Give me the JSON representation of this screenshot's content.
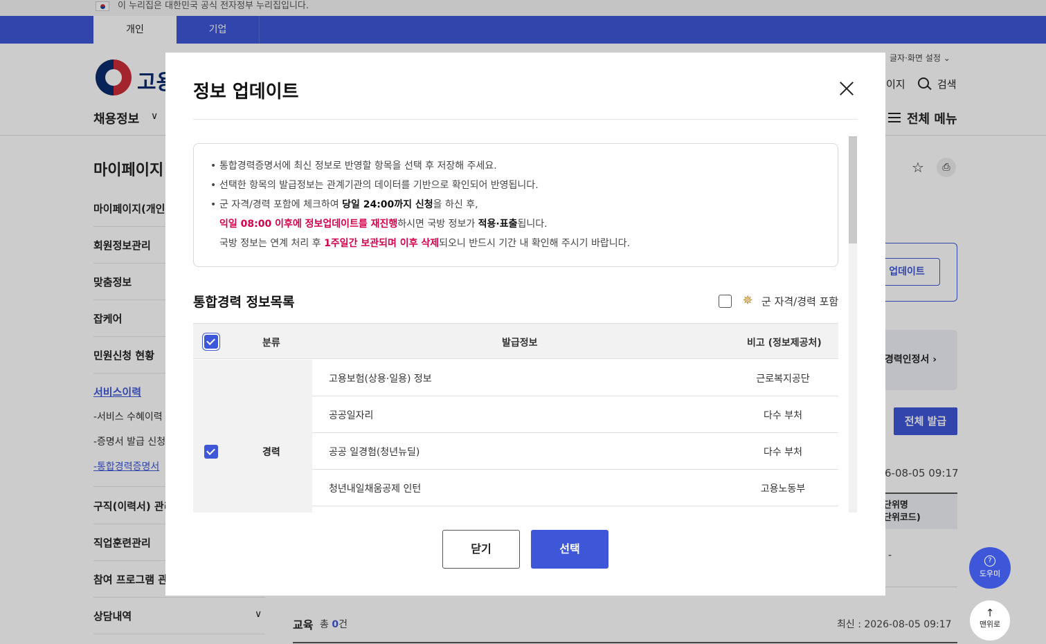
{
  "gov_banner": {
    "text": "이 누리집은 대한민국 공식 전자정부 누리집입니다."
  },
  "top_tabs": [
    {
      "label": "개인"
    },
    {
      "label": "기업"
    }
  ],
  "header": {
    "logo_text": "고용",
    "font_settings": "글자·화면 설정",
    "mypage_partial": "이지",
    "search_label": "검색",
    "gnb_first": "채용정보",
    "all_menu": "전체 메뉴"
  },
  "sidebar": {
    "title": "마이페이지",
    "items": [
      {
        "label": "마이페이지(개인)"
      },
      {
        "label": "회원정보관리"
      },
      {
        "label": "맞춤정보"
      },
      {
        "label": "잡케어"
      },
      {
        "label": "민원신청 현황"
      },
      {
        "label": "서비스이력"
      },
      {
        "label": "구직(이력서) 관리"
      },
      {
        "label": "직업훈련관리"
      },
      {
        "label": "참여 프로그램 관리"
      },
      {
        "label": "상담내역"
      }
    ],
    "subitems": [
      {
        "label": "-서비스 수혜이력"
      },
      {
        "label": "-증명서 발급 신청"
      },
      {
        "label": "-통합경력증명서"
      }
    ]
  },
  "background": {
    "update_btn": "업데이트",
    "card_label": "경력인정서",
    "all_issue": "전체 발급",
    "date1": "6-08-05 09:17",
    "th_line1": "단위명",
    "th_line2": "단위코드)",
    "dash": "-",
    "edu_label": "교육",
    "edu_total_prefix": "총",
    "edu_count": "0",
    "edu_total_suffix": "건",
    "edu_date": "최신 : 2026-08-05 09:17"
  },
  "floating": {
    "help": "도우미",
    "top": "맨위로"
  },
  "modal": {
    "title": "정보 업데이트",
    "notice": {
      "line1": "통합경력증명서에 최신 정보로 반영할 항목을 선택 후 저장해 주세요.",
      "line2": "선택한 항목의 발급정보는 관계기관의 데이터를 기반으로 확인되어 반영됩니다.",
      "line3_a": "군 자격/경력 포함에 체크하여 ",
      "line3_b": "당일 24:00까지 신청",
      "line3_c": "을 하신 후,",
      "line4_a": "익일 08:00 이후에 정보업데이트를 재진행",
      "line4_b": "하시면 국방 정보가 ",
      "line4_c": "적용·표출",
      "line4_d": "됩니다.",
      "line5_a": "국방 정보는 연계 처리 후 ",
      "line5_b": "1주일간 보관되며 이후 삭제",
      "line5_c": "되오니 반드시 기간 내 확인해 주시기 바랍니다."
    },
    "list_title": "통합경력 정보목록",
    "military_label": "군 자격/경력 포함",
    "military_checked": false,
    "table": {
      "headers": {
        "category": "분류",
        "info": "발급정보",
        "note": "비고 (정보제공처)"
      },
      "category": "경력",
      "rows": [
        {
          "info": "고용보험(상용·일용) 정보",
          "provider": "근로복지공단"
        },
        {
          "info": "공공일자리",
          "provider": "다수 부처"
        },
        {
          "info": "공공 일경험(청년뉴딜)",
          "provider": "다수 부처"
        },
        {
          "info": "청년내일채움공제 인턴",
          "provider": "고용노동부"
        }
      ]
    },
    "buttons": {
      "close": "닫기",
      "select": "선택"
    }
  },
  "colors": {
    "primary": "#3e57d8",
    "highlight": "#d6004c"
  }
}
